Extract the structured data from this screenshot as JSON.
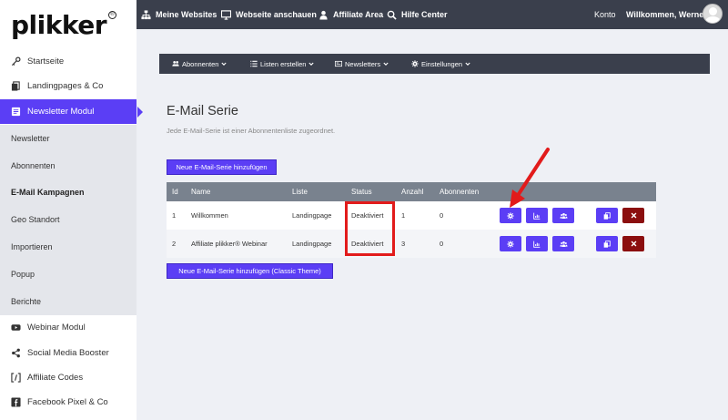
{
  "brand": {
    "logo_text": "plikker",
    "reg_mark": "®"
  },
  "sidebar": {
    "items": [
      {
        "label": "Startseite",
        "icon": "key-icon"
      },
      {
        "label": "Landingpages & Co",
        "icon": "copy-icon"
      },
      {
        "label": "Newsletter Modul",
        "icon": "newsletter-icon"
      },
      {
        "label": "Webinar Modul",
        "icon": "youtube-icon"
      },
      {
        "label": "Social Media Booster",
        "icon": "share-icon"
      },
      {
        "label": "Affiliate Codes",
        "icon": "brackets-icon"
      },
      {
        "label": "Facebook Pixel & Co",
        "icon": "facebook-icon"
      }
    ],
    "submenu": [
      "Newsletter",
      "Abonnenten",
      "E-Mail Kampagnen",
      "Geo Standort",
      "Importieren",
      "Popup",
      "Berichte"
    ]
  },
  "topbar": {
    "items": [
      {
        "label": "Meine Websites",
        "icon": "sitemap-icon"
      },
      {
        "label": "Webseite anschauen",
        "icon": "monitor-icon"
      },
      {
        "label": "Affiliate Area",
        "icon": "user-icon"
      },
      {
        "label": "Hilfe Center",
        "icon": "search-icon"
      }
    ],
    "account": "Konto",
    "welcome": "Willkommen, Werner"
  },
  "subnav": [
    {
      "label": "Abonnenten",
      "icon": "users-icon"
    },
    {
      "label": "Listen erstellen",
      "icon": "list-icon"
    },
    {
      "label": "Newsletters",
      "icon": "newspaper-icon"
    },
    {
      "label": "Einstellungen",
      "icon": "cog-icon"
    }
  ],
  "page": {
    "title": "E-Mail Serie",
    "subtitle": "Jede E-Mail-Serie ist einer Abonnentenliste zugeordnet.",
    "add_button": "Neue E-Mail-Serie hinzufügen",
    "add_classic_button": "Neue E-Mail-Serie hinzufügen (Classic Theme)"
  },
  "table": {
    "headers": [
      "Id",
      "Name",
      "Liste",
      "Status",
      "Anzahl",
      "Abonnenten"
    ],
    "rows": [
      {
        "id": "1",
        "name": "Willkommen",
        "list": "Landingpage",
        "status": "Deaktiviert",
        "count": "1",
        "subscribers": "0"
      },
      {
        "id": "2",
        "name": "Affiliate plikker® Webinar",
        "list": "Landingpage",
        "status": "Deaktiviert",
        "count": "3",
        "subscribers": "0"
      }
    ]
  },
  "colors": {
    "accent": "#5b3ef5",
    "dark_bar": "#3a3f4c",
    "table_header": "#79828e",
    "danger": "#8b0e0e",
    "highlight": "#e21b1b"
  }
}
